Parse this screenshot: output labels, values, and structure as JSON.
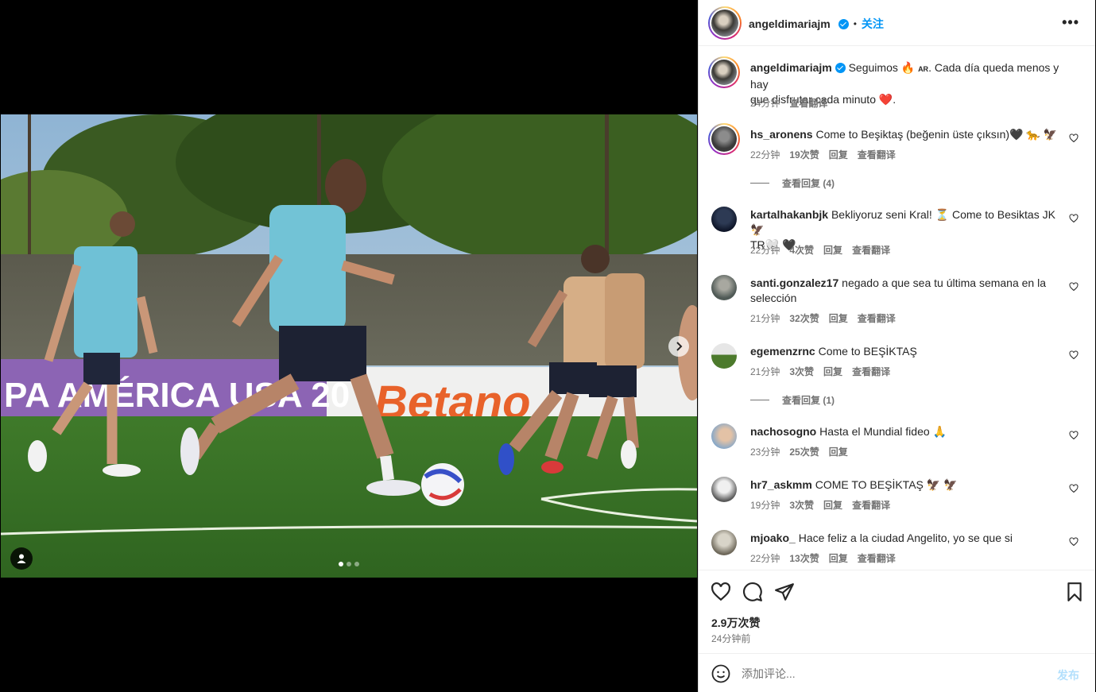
{
  "header": {
    "username": "angeldimariajm",
    "separator": "•",
    "follow_label": "关注",
    "more_label": "•••"
  },
  "media": {
    "banner_text_left": "PA AMÉRICA USA 20",
    "banner_text_right": "Betano",
    "carousel_total": 3,
    "carousel_active": 1
  },
  "caption": {
    "username": "angeldimariajm",
    "text_a": "Seguimos 🔥",
    "flag": "AR",
    "text_b": ". Cada día queda menos y hay",
    "text_c": "que disfrutar cada minuto ❤️.",
    "time": "24分钟",
    "translate": "查看翻译"
  },
  "comments": [
    {
      "username": "hs_aronens",
      "text": "Come to Beşiktaş (beğenin üste çıksın)🖤 🐆 🦅",
      "time": "22分钟",
      "likes": "19次赞",
      "reply": "回复",
      "translate": "查看翻译",
      "view_replies": "查看回复 (4)"
    },
    {
      "username": "kartalhakanbjk",
      "text": "Bekliyoruz seni Kral! ⏳ Come to Besiktas JK 🦅",
      "text2": "TR🤍 🖤",
      "time": "22分钟",
      "likes": "4次赞",
      "reply": "回复",
      "translate": "查看翻译"
    },
    {
      "username": "santi.gonzalez17",
      "text": "negado a que sea tu última semana en la",
      "text2": "selección",
      "time": "21分钟",
      "likes": "32次赞",
      "reply": "回复",
      "translate": "查看翻译"
    },
    {
      "username": "egemenzrnc",
      "text": "Come to BEŞİKTAŞ",
      "time": "21分钟",
      "likes": "3次赞",
      "reply": "回复",
      "translate": "查看翻译",
      "view_replies": "查看回复 (1)"
    },
    {
      "username": "nachosogno",
      "text": "Hasta el Mundial fideo 🙏",
      "time": "23分钟",
      "likes": "25次赞",
      "reply": "回复"
    },
    {
      "username": "hr7_askmm",
      "text": "COME TO BEŞİKTAŞ 🦅 🦅",
      "time": "19分钟",
      "likes": "3次赞",
      "reply": "回复",
      "translate": "查看翻译"
    },
    {
      "username": "mjoako_",
      "text": "Hace feliz a la ciudad Angelito, yo se que si",
      "time": "22分钟",
      "likes": "13次赞",
      "reply": "回复",
      "translate": "查看翻译"
    }
  ],
  "stats": {
    "likes": "2.9万次赞",
    "posted": "24分钟前"
  },
  "composer": {
    "placeholder": "添加评论...",
    "post_label": "发布"
  },
  "icons": {
    "like": "heart-icon",
    "comment": "comment-icon",
    "share": "share-icon",
    "save": "bookmark-icon",
    "emoji": "emoji-icon",
    "tag": "user-tag-icon",
    "next": "chevron-right-icon"
  },
  "colors": {
    "accent": "#0095f6",
    "post_disabled": "#b2dffc",
    "muted": "#737373"
  }
}
